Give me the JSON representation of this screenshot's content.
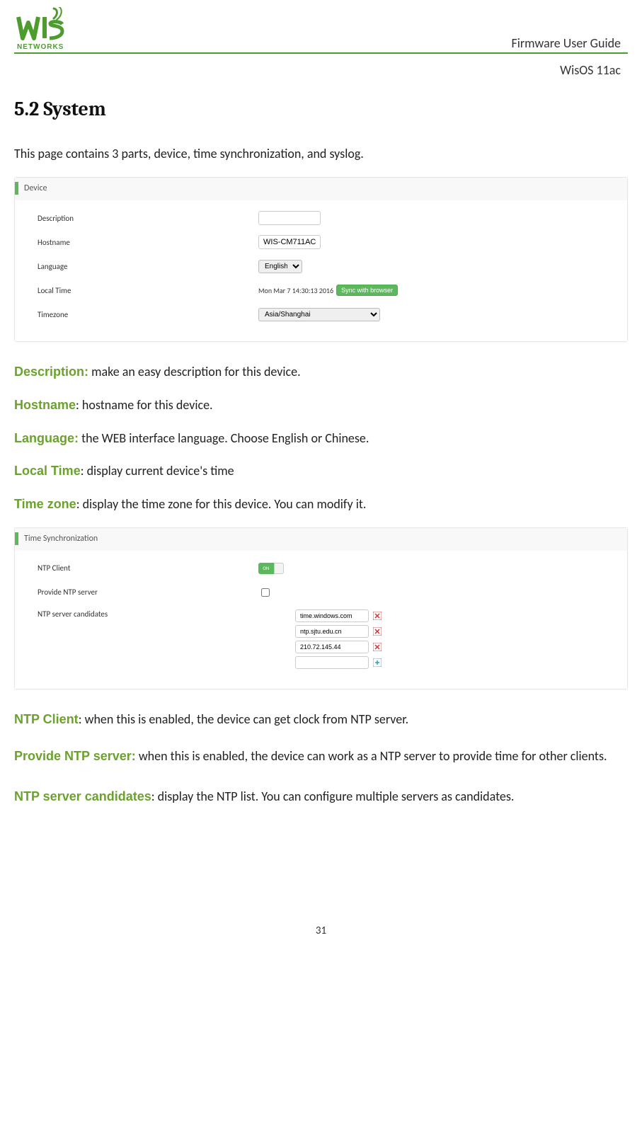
{
  "header": {
    "brand_name": "WIS NETWORKS",
    "guide_title": "Firmware User Guide",
    "subtitle": "WisOS 11ac"
  },
  "section": {
    "number": "5.2",
    "title": "System",
    "intro": "This page contains 3 parts, device, time synchronization, and syslog."
  },
  "device_panel": {
    "title": "Device",
    "rows": {
      "description": {
        "label": "Description",
        "value": ""
      },
      "hostname": {
        "label": "Hostname",
        "value": "WIS-CM711AC"
      },
      "language": {
        "label": "Language",
        "selected": "English"
      },
      "local_time": {
        "label": "Local Time",
        "value": "Mon Mar 7 14:30:13 2016",
        "button": "Sync with browser"
      },
      "timezone": {
        "label": "Timezone",
        "selected": "Asia/Shanghai"
      }
    }
  },
  "device_defs": {
    "description": {
      "term": "Description:",
      "text": " make an easy description for this device."
    },
    "hostname": {
      "term": "Hostname",
      "text": ": hostname for this device."
    },
    "language": {
      "term": "Language:",
      "text": " the WEB interface language. Choose English or Chinese."
    },
    "local_time": {
      "term": "Local Time",
      "text": ": display current device's time"
    },
    "timezone": {
      "term": "Time zone",
      "text": ": display the time zone for this device. You can modify it."
    }
  },
  "time_panel": {
    "title": "Time Synchronization",
    "rows": {
      "ntp_client": {
        "label": "NTP Client",
        "state": "ON"
      },
      "provide_ntp": {
        "label": "Provide NTP server",
        "checked": false
      },
      "candidates": {
        "label": "NTP server candidates",
        "items": [
          "time.windows.com",
          "ntp.sjtu.edu.cn",
          "210.72.145.44",
          ""
        ]
      }
    }
  },
  "time_defs": {
    "ntp_client": {
      "term": "NTP Client",
      "text": ": when this is enabled, the device can get clock from NTP server."
    },
    "provide_ntp": {
      "term": "Provide NTP server:",
      "text": " when this is enabled, the device can work as a NTP server to provide time for other clients."
    },
    "candidates": {
      "term": "NTP server candidates",
      "text": ": display the NTP list. You can configure multiple servers as candidates."
    }
  },
  "page_number": "31"
}
